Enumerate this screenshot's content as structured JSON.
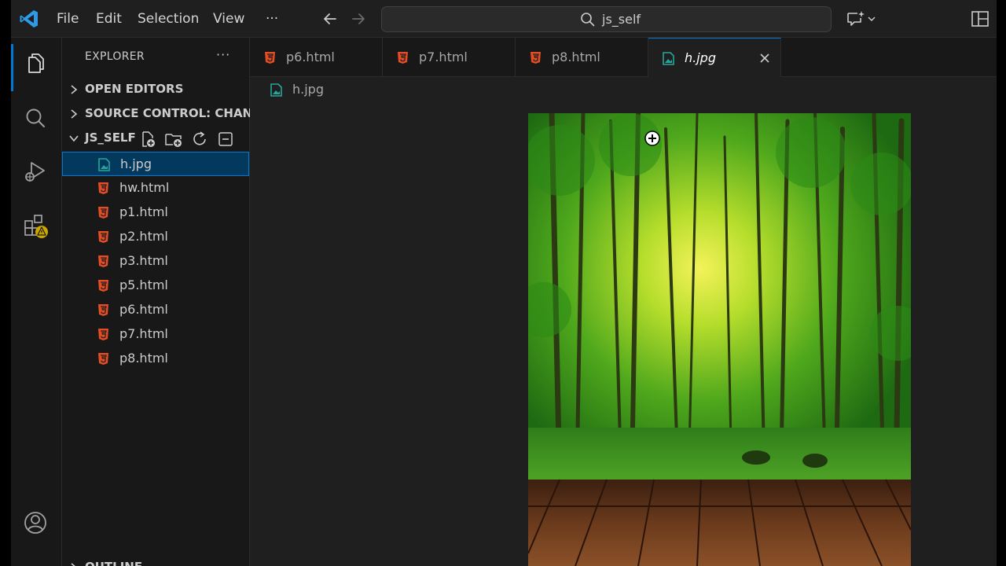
{
  "titlebar": {
    "menus": [
      "File",
      "Edit",
      "Selection",
      "View"
    ],
    "more": "···",
    "search_text": "js_self"
  },
  "sidebar": {
    "title": "EXPLORER",
    "more": "···",
    "open_editors": "OPEN EDITORS",
    "source_control": "SOURCE CONTROL: CHAN...",
    "folder": "JS_SELF",
    "outline": "OUTLINE",
    "files": [
      "h.jpg",
      "hw.html",
      "p1.html",
      "p2.html",
      "p3.html",
      "p5.html",
      "p6.html",
      "p7.html",
      "p8.html"
    ],
    "selected_file": "h.jpg"
  },
  "tabs": [
    "p6.html",
    "p7.html",
    "p8.html",
    "h.jpg"
  ],
  "active_tab": "h.jpg",
  "breadcrumb": "h.jpg",
  "colors": {
    "accent": "#0078d4",
    "html_icon": "#e44d26",
    "image_icon": "#26a69a",
    "warning": "#cca700"
  }
}
